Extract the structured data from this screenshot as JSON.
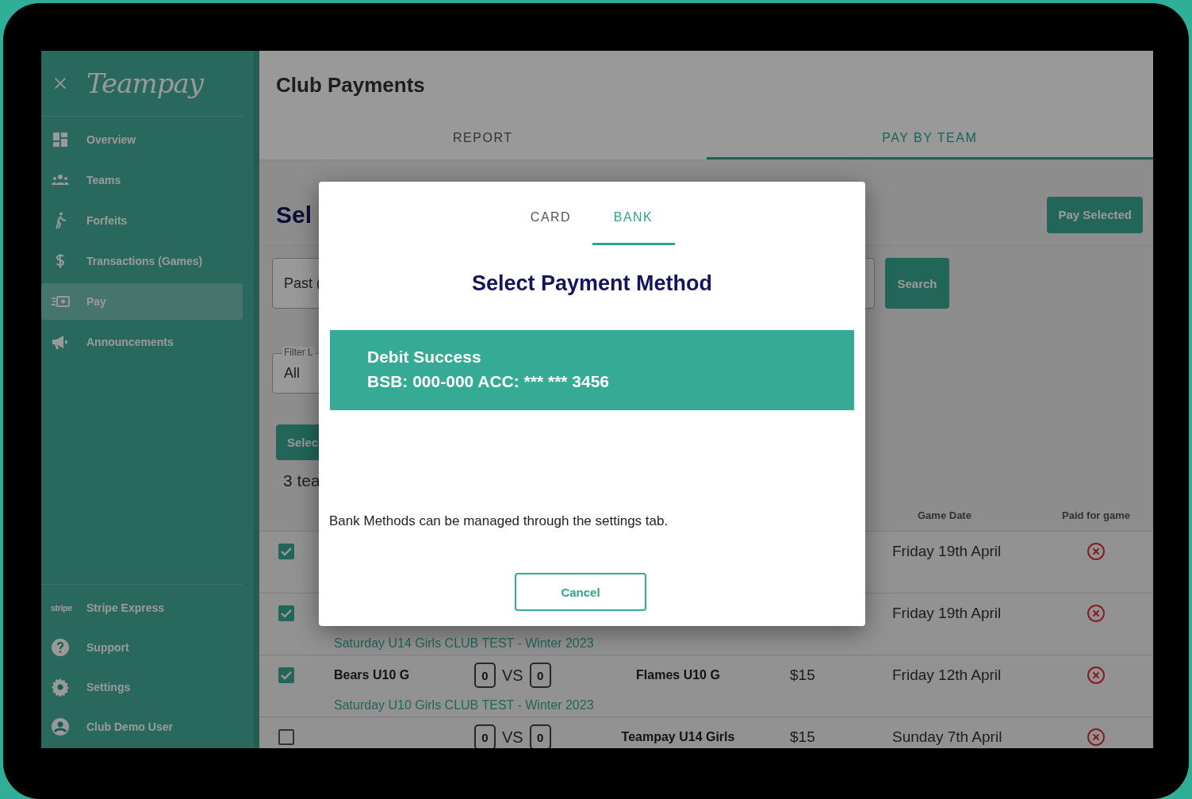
{
  "sidebar": {
    "logo": "Teampay",
    "items": [
      {
        "label": "Overview",
        "selected": false
      },
      {
        "label": "Teams",
        "selected": false
      },
      {
        "label": "Forfeits",
        "selected": false
      },
      {
        "label": "Transactions (Games)",
        "selected": false
      },
      {
        "label": "Pay",
        "selected": true
      },
      {
        "label": "Announcements",
        "selected": false
      }
    ],
    "bottom_items": [
      {
        "label": "Stripe Express",
        "icon_text": "stripe"
      },
      {
        "label": "Support"
      },
      {
        "label": "Settings"
      },
      {
        "label": "Club Demo User"
      }
    ]
  },
  "page": {
    "title": "Club Payments",
    "tabs": [
      {
        "label": "REPORT",
        "selected": false
      },
      {
        "label": "PAY BY TEAM",
        "selected": true
      }
    ]
  },
  "content": {
    "heading": "Sel",
    "pay_selected_button": "Pay Selected",
    "date_field": {
      "value": "Past ("
    },
    "search_button": "Search",
    "filter_field": {
      "label": "Filter L",
      "value": "All"
    },
    "select_button": "Selec",
    "count": "3 tea"
  },
  "table": {
    "columns": [
      "Game Date",
      "Paid for game"
    ],
    "rows": [
      {
        "checked": true,
        "date": "Friday 19th April",
        "paid": false
      },
      {
        "checked": true,
        "date": "Friday 19th April",
        "paid": false,
        "league": "Saturday U14 Girls CLUB TEST - Winter 2023"
      },
      {
        "checked": true,
        "home": "Bears U10 G",
        "home_score": "0",
        "vs": "VS",
        "away_score": "0",
        "away": "Flames U10 G",
        "amount": "$15",
        "date": "Friday 12th April",
        "paid": false,
        "league": "Saturday U10 Girls CLUB TEST - Winter 2023"
      },
      {
        "checked": false,
        "home_score": "0",
        "vs": "VS",
        "away_score": "0",
        "away": "Teampay U14 Girls",
        "amount": "$15",
        "date": "Sunday 7th April",
        "paid": false
      }
    ]
  },
  "modal": {
    "tabs": [
      {
        "label": "CARD",
        "selected": false
      },
      {
        "label": "BANK",
        "selected": true
      }
    ],
    "title": "Select Payment Method",
    "bank_card": {
      "name": "Debit Success",
      "details": "BSB: 000-000 ACC: *** *** 3456"
    },
    "note": "Bank Methods can be managed through the settings tab.",
    "cancel_button": "Cancel"
  }
}
